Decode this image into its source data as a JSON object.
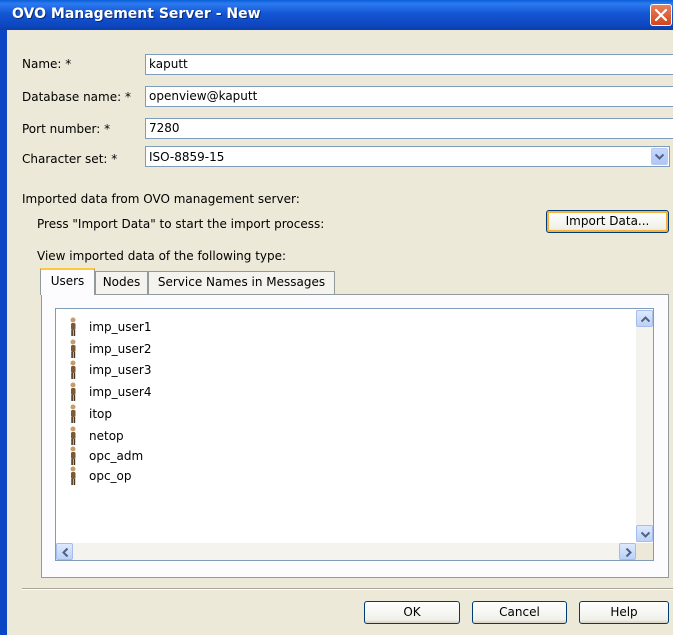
{
  "window": {
    "title": "OVO Management Server - New"
  },
  "form": {
    "name_label": "Name: *",
    "name_value": "kaputt",
    "database_label": "Database name: *",
    "database_value": "openview@kaputt",
    "port_label": "Port number: *",
    "port_value": "7280",
    "charset_label": "Character set: *",
    "charset_value": "ISO-8859-15"
  },
  "import": {
    "section_label": "Imported data from OVO management server:",
    "instruction": "Press \"Import Data\" to start the import process:",
    "button_label": "Import Data...",
    "view_label": "View imported data of the following type:"
  },
  "tabs": [
    {
      "label": "Users"
    },
    {
      "label": "Nodes"
    },
    {
      "label": "Service Names in Messages"
    }
  ],
  "users": [
    {
      "name": "imp_user1"
    },
    {
      "name": "imp_user2"
    },
    {
      "name": "imp_user3"
    },
    {
      "name": "imp_user4"
    },
    {
      "name": "itop"
    },
    {
      "name": "netop"
    },
    {
      "name": "opc_adm"
    },
    {
      "name": "opc_op"
    }
  ],
  "icons": {
    "user": "user-icon",
    "close": "close-icon",
    "dropdown": "chevron-down-icon"
  },
  "footer": {
    "ok_label": "OK",
    "cancel_label": "Cancel",
    "help_label": "Help"
  },
  "colors": {
    "titlebar": "#0d46bf",
    "dialog_bg": "#ece9d8",
    "close_button": "#d4441c",
    "active_tab_accent": "#ffc83c"
  }
}
